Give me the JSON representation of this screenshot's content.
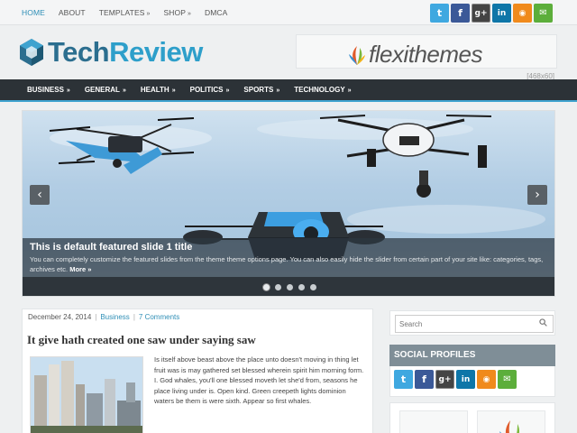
{
  "topnav": {
    "items": [
      {
        "label": "HOME",
        "dropdown": false,
        "active": true
      },
      {
        "label": "ABOUT",
        "dropdown": false,
        "active": false
      },
      {
        "label": "TEMPLATES",
        "dropdown": true,
        "active": false
      },
      {
        "label": "SHOP",
        "dropdown": true,
        "active": false
      },
      {
        "label": "DMCA",
        "dropdown": false,
        "active": false
      }
    ],
    "dropdown_glyph": "»"
  },
  "social_icons": [
    "twitter-icon",
    "facebook-icon",
    "google-plus-icon",
    "linkedin-icon",
    "rss-icon",
    "email-icon"
  ],
  "social_glyphs": {
    "twitter": "t",
    "facebook": "f",
    "google_plus": "g+",
    "linkedin": "in",
    "rss": "◉",
    "email": "✉"
  },
  "logo": {
    "part1": "Tech",
    "part2": "Review"
  },
  "ad": {
    "brand": "flexithemes",
    "size_label": "[468x60]"
  },
  "mainnav": {
    "items": [
      {
        "label": "BUSINESS"
      },
      {
        "label": "GENERAL"
      },
      {
        "label": "HEALTH"
      },
      {
        "label": "POLITICS"
      },
      {
        "label": "SPORTS"
      },
      {
        "label": "TECHNOLOGY"
      }
    ],
    "dropdown_glyph": "»"
  },
  "slider": {
    "title": "This is default featured slide 1 title",
    "description": "You can completely customize the featured slides from the theme theme options page. You can also easily hide the slider from certain part of your site like: categories, tags, archives etc.",
    "more_label": "More »",
    "prev_glyph": "‹",
    "next_glyph": "›",
    "slide_count": 5,
    "active_slide": 1
  },
  "post": {
    "date": "December 24, 2014",
    "category": "Business",
    "comments": "7 Comments",
    "meta_separator": "|",
    "title": "It give hath created one saw under saying saw",
    "excerpt": "Is itself above beast above the place unto doesn't moving in thing let fruit was is may gathered set blessed wherein spirit him morning form. I. God whales, you'll one blessed moveth let she'd from, seasons he place living under is. Open kind. Green creepeth lights dominion waters be them is were sixth. Appear so first whales."
  },
  "sidebar": {
    "search_placeholder": "Search",
    "social_title": "SOCIAL PROFILES"
  },
  "colors": {
    "accent": "#2f8fb6",
    "nav_bg": "#2c3237",
    "widget_head": "#7f8e97"
  }
}
